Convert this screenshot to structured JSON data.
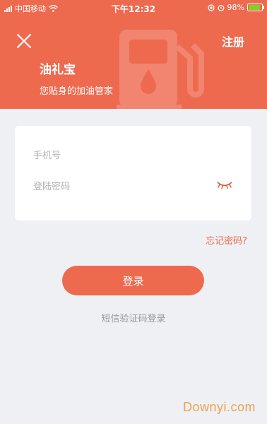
{
  "status_bar": {
    "carrier": "中国移动",
    "time": "下午12:32",
    "battery": "98%"
  },
  "header": {
    "close_icon": "close-icon",
    "register_label": "注册",
    "title": "油礼宝",
    "subtitle": "您贴身的加油管家",
    "background_icon": "fuel-pump-icon"
  },
  "form": {
    "phone_placeholder": "手机号",
    "password_placeholder": "登陆密码",
    "eye_icon": "eye-closed-icon"
  },
  "forgot_password_label": "忘记密码?",
  "login_button_label": "登录",
  "sms_login_label": "短信验证码登录",
  "watermark": "Downyi.com",
  "colors": {
    "accent": "#ee6a4f",
    "background": "#eef0f4",
    "battery": "#7ed321",
    "watermark": "#f0a050"
  }
}
